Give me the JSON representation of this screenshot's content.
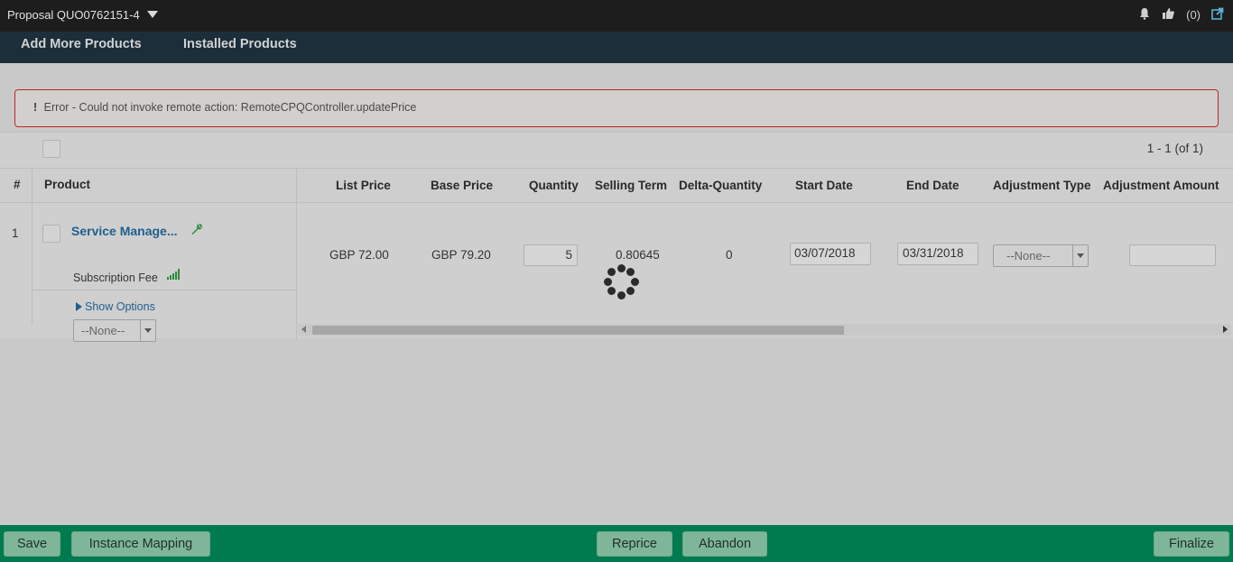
{
  "topbar": {
    "proposal_title": "Proposal QUO0762151-4",
    "likes_count": "(0)",
    "icons": [
      "bell-icon",
      "thumbs-up-icon",
      "share-icon"
    ]
  },
  "nav": {
    "add_more_products": "Add More Products",
    "installed_products": "Installed Products"
  },
  "error": {
    "mark": "!",
    "message": "Error - Could not invoke remote action: RemoteCPQController.updatePrice"
  },
  "grid": {
    "pager": "1 - 1 (of 1)",
    "headers": {
      "num": "#",
      "product": "Product",
      "list_price": "List Price",
      "base_price": "Base Price",
      "quantity": "Quantity",
      "selling_term": "Selling Term",
      "delta_quantity": "Delta-Quantity",
      "start_date": "Start Date",
      "end_date": "End Date",
      "adjustment_type": "Adjustment Type",
      "adjustment_amount": "Adjustment Amount"
    },
    "row": {
      "num": "1",
      "product_name": "Service Manage...",
      "charge_type": "Subscription Fee",
      "show_options": "Show Options",
      "options_select": "--None--",
      "list_price": "GBP 72.00",
      "base_price": "GBP 79.20",
      "quantity": "5",
      "selling_term": "0.80645",
      "delta_quantity": "0",
      "start_date": "03/07/2018",
      "end_date": "03/31/2018",
      "adjustment_type": "--None--",
      "adjustment_amount": ""
    },
    "scroll_position": 0
  },
  "footer": {
    "save": "Save",
    "instance_mapping": "Instance Mapping",
    "reprice": "Reprice",
    "abandon": "Abandon",
    "finalize": "Finalize"
  },
  "colors": {
    "footer_bg": "#007b50",
    "nav_bg": "#1b2e3a",
    "error_border": "#b82929",
    "link": "#1f5f8f"
  }
}
